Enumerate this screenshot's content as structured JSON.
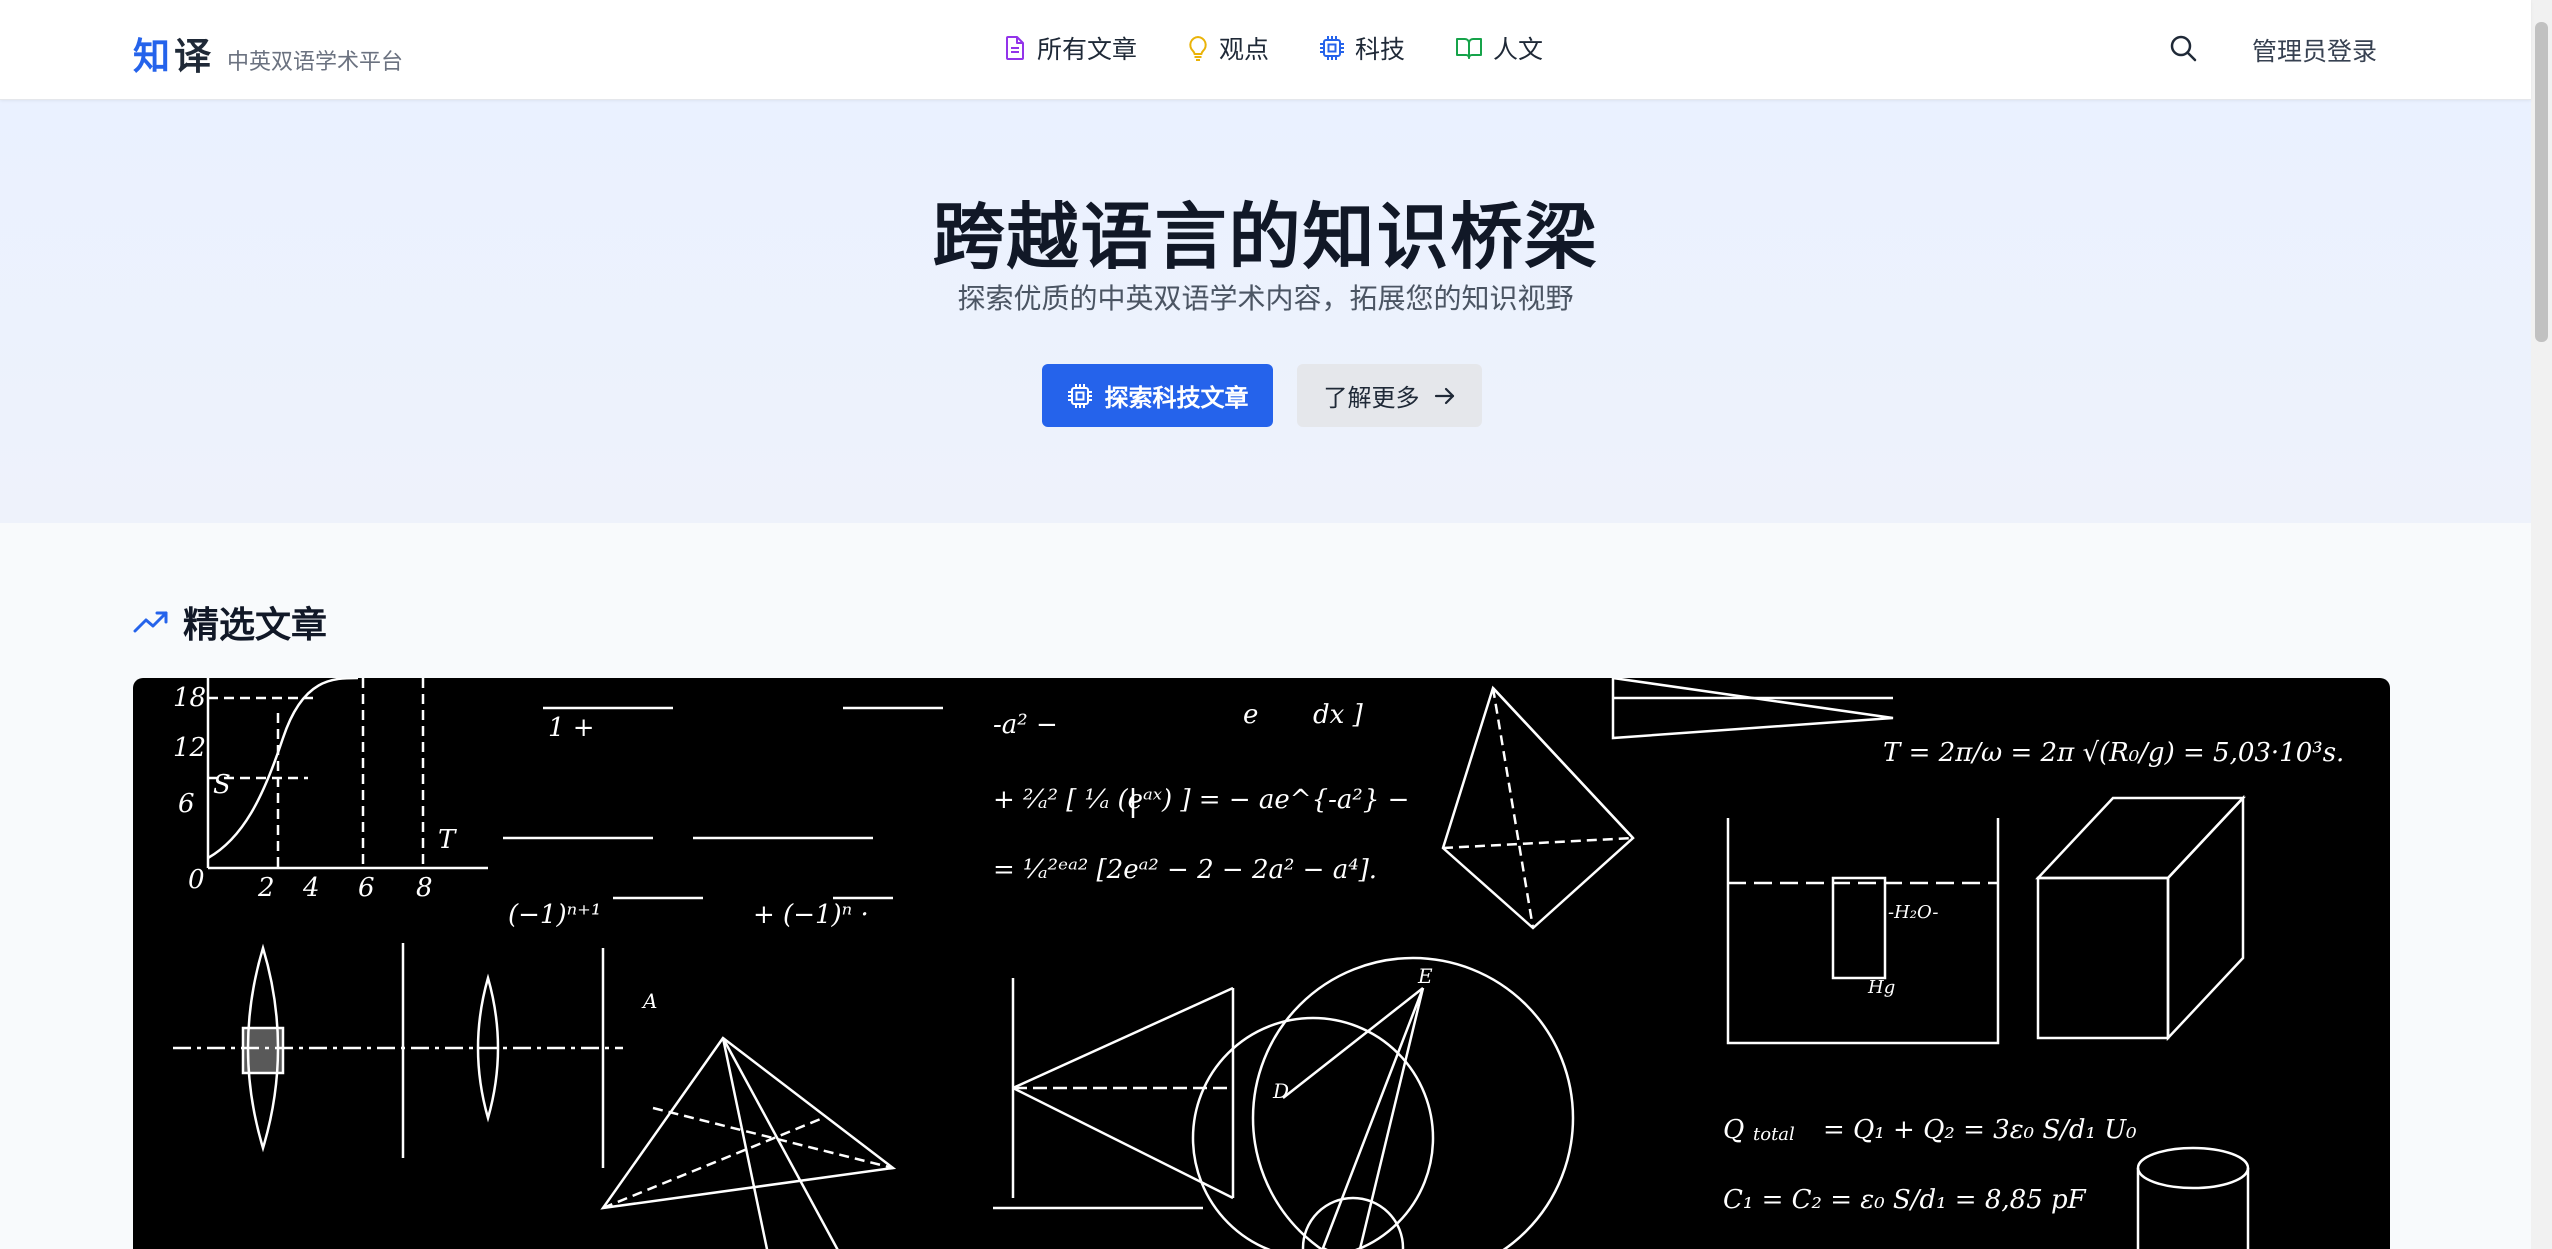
{
  "header": {
    "logo_char1": "知",
    "logo_char2": "译",
    "logo_tagline": "中英双语学术平台",
    "nav": [
      {
        "label": "所有文章",
        "icon": "document-icon",
        "color": "#9333ea"
      },
      {
        "label": "观点",
        "icon": "lightbulb-icon",
        "color": "#eab308"
      },
      {
        "label": "科技",
        "icon": "chip-icon",
        "color": "#2563eb"
      },
      {
        "label": "人文",
        "icon": "book-icon",
        "color": "#16a34a"
      }
    ],
    "search_icon": "search-icon",
    "login_label": "管理员登录"
  },
  "hero": {
    "title": "跨越语言的知识桥梁",
    "subtitle": "探索优质的中英双语学术内容，拓展您的知识视野",
    "primary_button": "探索科技文章",
    "secondary_button": "了解更多"
  },
  "featured": {
    "section_title": "精选文章",
    "image_description_icon": "trending-up-icon"
  },
  "colors": {
    "accent": "#2563eb",
    "hero_bg": "#eaf1ff",
    "page_bg": "#f8fafc"
  }
}
